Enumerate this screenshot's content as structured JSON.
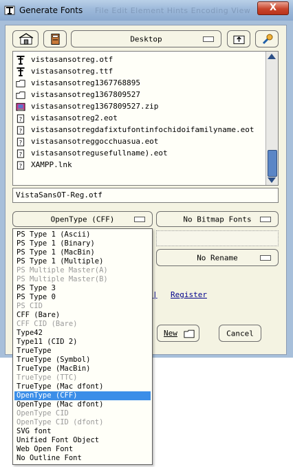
{
  "window": {
    "title": "Generate Fonts",
    "background_menu_ghost": "File  Edit  Element  Hints  Encoding  View",
    "close_glyph": "X"
  },
  "toolbar": {
    "directory_label": "Desktop"
  },
  "files": [
    {
      "name": "vistasansotreg.otf",
      "icon": "font-file-icon"
    },
    {
      "name": "vistasansotreg.ttf",
      "icon": "font-file-icon"
    },
    {
      "name": "vistasansotreg1367768895",
      "icon": "folder-icon"
    },
    {
      "name": "vistasansotreg1367809527",
      "icon": "folder-icon"
    },
    {
      "name": "vistasansotreg1367809527.zip",
      "icon": "archive-icon"
    },
    {
      "name": "vistasansotreg2.eot",
      "icon": "unknown-file-icon"
    },
    {
      "name": "vistasansotregdafixtufontinfochidoifamilyname.eot",
      "icon": "unknown-file-icon"
    },
    {
      "name": "vistasansotreggocchuasua.eot",
      "icon": "unknown-file-icon"
    },
    {
      "name": "vistasansotregusefullname).eot",
      "icon": "unknown-file-icon"
    },
    {
      "name": "XAMPP.lnk",
      "icon": "unknown-file-icon"
    }
  ],
  "filename": {
    "value": "VistaSansOT-Reg.otf"
  },
  "outline_format": {
    "selected": "OpenType (CFF)"
  },
  "bitmap_format": {
    "selected": "No Bitmap Fonts"
  },
  "rename": {
    "selected": "No Rename"
  },
  "links": {
    "partial_label": "|",
    "register": "Register"
  },
  "buttons": {
    "new_label": "New",
    "cancel_label": "Cancel"
  },
  "format_options": [
    {
      "label": "PS Type 1 (Ascii)",
      "state": "enabled"
    },
    {
      "label": "PS Type 1 (Binary)",
      "state": "enabled"
    },
    {
      "label": "PS Type 1 (MacBin)",
      "state": "enabled"
    },
    {
      "label": "PS Type 1 (Multiple)",
      "state": "enabled"
    },
    {
      "label": "PS Multiple Master(A)",
      "state": "disabled"
    },
    {
      "label": "PS Multiple Master(B)",
      "state": "disabled"
    },
    {
      "label": "PS Type 3",
      "state": "enabled"
    },
    {
      "label": "PS Type 0",
      "state": "enabled"
    },
    {
      "label": "PS CID",
      "state": "disabled"
    },
    {
      "label": "CFF (Bare)",
      "state": "enabled"
    },
    {
      "label": "CFF CID (Bare)",
      "state": "disabled"
    },
    {
      "label": "Type42",
      "state": "enabled"
    },
    {
      "label": "Type11 (CID 2)",
      "state": "enabled"
    },
    {
      "label": "TrueType",
      "state": "enabled"
    },
    {
      "label": "TrueType (Symbol)",
      "state": "enabled"
    },
    {
      "label": "TrueType (MacBin)",
      "state": "enabled"
    },
    {
      "label": "TrueType (TTC)",
      "state": "disabled"
    },
    {
      "label": "TrueType (Mac dfont)",
      "state": "enabled"
    },
    {
      "label": "OpenType (CFF)",
      "state": "selected"
    },
    {
      "label": "OpenType (Mac dfont)",
      "state": "enabled"
    },
    {
      "label": "OpenType CID",
      "state": "disabled"
    },
    {
      "label": "OpenType CID (dfont)",
      "state": "disabled"
    },
    {
      "label": "SVG font",
      "state": "enabled"
    },
    {
      "label": "Unified Font Object",
      "state": "enabled"
    },
    {
      "label": "Web Open Font",
      "state": "enabled"
    },
    {
      "label": "No Outline Font",
      "state": "enabled"
    }
  ],
  "colors": {
    "title_bar": "#9db9da",
    "dialog_bg": "#f4f3e2",
    "selection": "#3b8ee8",
    "close_button": "#c8452c",
    "link": "#00008b"
  }
}
